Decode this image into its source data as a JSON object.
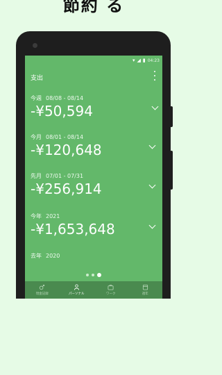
{
  "banner": {
    "text": "節約 る"
  },
  "status": {
    "time": "04:23"
  },
  "header": {
    "title": "支出"
  },
  "periods": [
    {
      "name": "今週",
      "range": "08/08 - 08/14",
      "amount": "-¥50,594"
    },
    {
      "name": "今月",
      "range": "08/01 - 08/14",
      "amount": "-¥120,648"
    },
    {
      "name": "先月",
      "range": "07/01 - 07/31",
      "amount": "-¥256,914"
    },
    {
      "name": "今年",
      "range": "2021",
      "amount": "-¥1,653,648"
    },
    {
      "name": "去年",
      "range": "2020",
      "amount": ""
    }
  ],
  "pager": {
    "count": 3,
    "active_index": 2
  },
  "tabs": [
    {
      "label": "現金記録",
      "icon": "gender-icon",
      "active": false
    },
    {
      "label": "パーソナル",
      "icon": "person-icon",
      "active": true
    },
    {
      "label": "ワーク",
      "icon": "briefcase-icon",
      "active": false
    },
    {
      "label": "週年",
      "icon": "calendar-icon",
      "active": false
    }
  ],
  "colors": {
    "screen": "#63b86a",
    "tabbar": "#4a8a4f",
    "page_bg": "#e6fbe6"
  }
}
